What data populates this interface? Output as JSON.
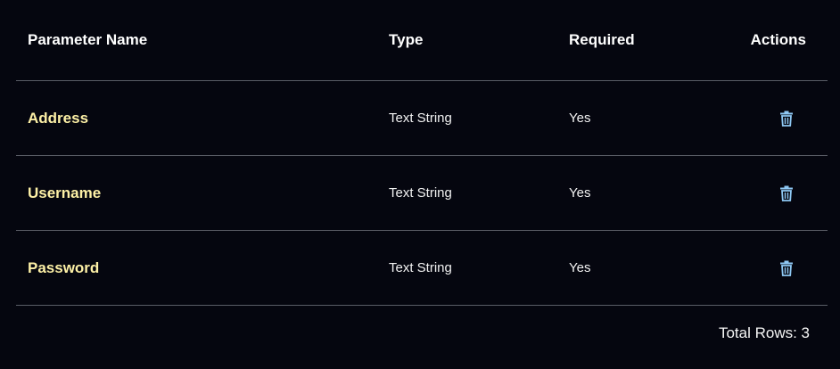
{
  "columns": {
    "name": "Parameter Name",
    "type": "Type",
    "required": "Required",
    "actions": "Actions"
  },
  "rows": [
    {
      "name": "Address",
      "type": "Text String",
      "required": "Yes",
      "action_icon": "trash-icon"
    },
    {
      "name": "Username",
      "type": "Text String",
      "required": "Yes",
      "action_icon": "trash-icon"
    },
    {
      "name": "Password",
      "type": "Text String",
      "required": "Yes",
      "action_icon": "trash-icon"
    }
  ],
  "footer": {
    "total_rows": "Total Rows: 3"
  },
  "colors": {
    "background": "#05060f",
    "param_name": "#fdf0a6",
    "divider": "#5a5d66",
    "icon": "#8ec8f4"
  }
}
